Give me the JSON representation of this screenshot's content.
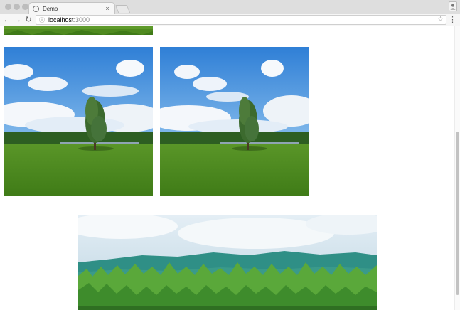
{
  "browser": {
    "tab_title": "Demo",
    "tab_close": "×",
    "url_host": "localhost",
    "url_port": ":3000",
    "icons": {
      "back": "←",
      "forward": "→",
      "reload": "↻",
      "page_info": "ⓘ",
      "bookmark": "☆",
      "menu": "⋮",
      "favicon": "i"
    }
  },
  "page": {
    "images": [
      {
        "id": "partial-top",
        "kind": "meadow-field"
      },
      {
        "id": "tree-left",
        "kind": "meadow-tree"
      },
      {
        "id": "tree-right",
        "kind": "meadow-tree"
      },
      {
        "id": "forest",
        "kind": "forest-hills"
      }
    ]
  },
  "colors": {
    "sky": "#3d8fdc",
    "grass": "#4f8a1f",
    "forest": "#3e8c2c",
    "hills": "#2f8f86"
  }
}
